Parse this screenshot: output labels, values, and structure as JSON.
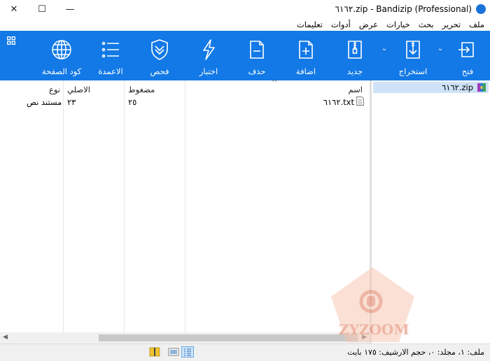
{
  "window": {
    "title": "٦١٦٢.zip - Bandizip (Professional)",
    "close_glyph": "✕",
    "maximize_glyph": "☐",
    "minimize_glyph": "—"
  },
  "menu": [
    "ملف",
    "تحرير",
    "بحث",
    "خيارات",
    "عرض",
    "أدوات",
    "تعليمات"
  ],
  "toolbar": {
    "open": "فتح",
    "extract": "استخراج",
    "new": "جديد",
    "add": "اضافة",
    "delete": "حذف",
    "test": "اختبار",
    "scan": "فحص",
    "columns": "الاعمدة",
    "codepage": "كود الصفحة",
    "accent": "#1279e6"
  },
  "columns": {
    "name": "اسم",
    "compressed": "مضغوط",
    "original": "الاصلي",
    "type": "نوع"
  },
  "files": [
    {
      "name": "٦١٦٢.txt",
      "compressed": "٢٥",
      "original": "٢٣",
      "type": "مستند نص"
    }
  ],
  "tree": {
    "root": "٦١٦٢.zip"
  },
  "status": "ملف: ١، مجلد: ٠، حجم الارشيف: ١٧٥ بايت",
  "watermark": "ZYZOOM"
}
